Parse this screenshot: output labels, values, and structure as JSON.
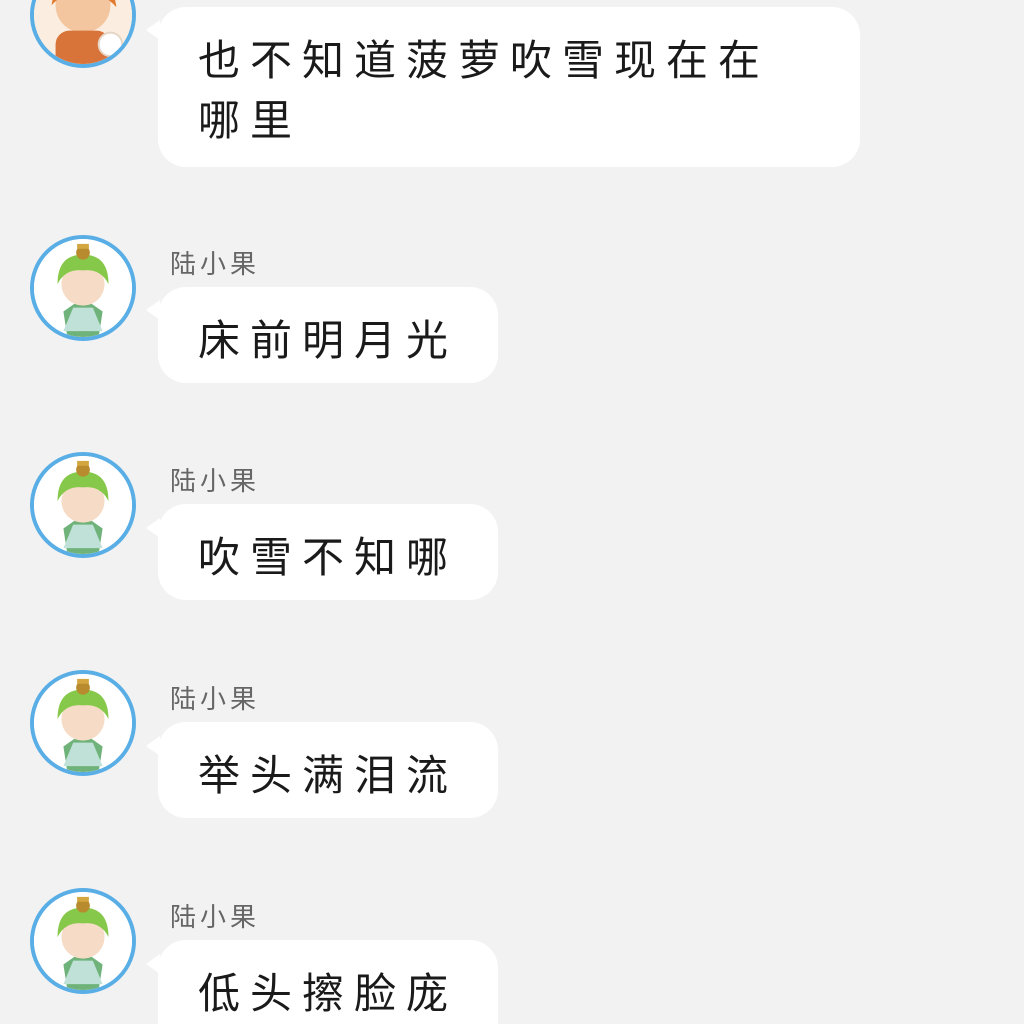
{
  "messages": [
    {
      "avatar": "orange-hair-character-avatar",
      "sender": "",
      "text": "也不知道菠萝吹雪现在在哪里"
    },
    {
      "avatar": "green-hair-character-avatar",
      "sender": "陆小果",
      "text": "床前明月光"
    },
    {
      "avatar": "green-hair-character-avatar",
      "sender": "陆小果",
      "text": "吹雪不知哪"
    },
    {
      "avatar": "green-hair-character-avatar",
      "sender": "陆小果",
      "text": "举头满泪流"
    },
    {
      "avatar": "green-hair-character-avatar",
      "sender": "陆小果",
      "text": "低头擦脸庞"
    }
  ],
  "colors": {
    "background": "#f2f2f2",
    "bubble": "#ffffff",
    "avatar_ring": "#5aaee6",
    "text": "#1a1a1a",
    "sender": "#666666"
  }
}
